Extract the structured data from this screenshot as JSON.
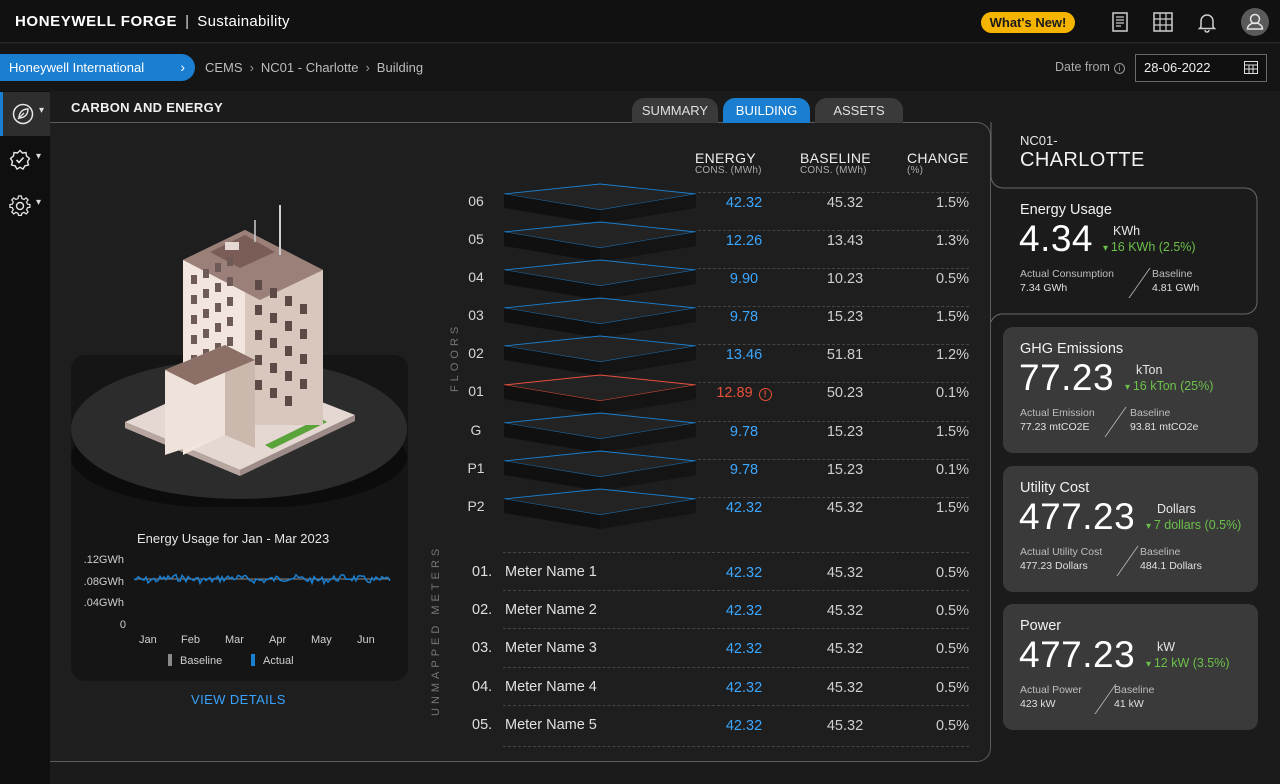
{
  "header": {
    "brand": "HONEYWELL FORGE",
    "separator": "|",
    "product": "Sustainability",
    "whats_new": "What's New!",
    "icons": [
      "document-icon",
      "grid-icon",
      "bell-icon",
      "user-icon"
    ]
  },
  "breadcrumb": {
    "tenant": "Honeywell International",
    "tenant_chevron": "›",
    "items": [
      "CEMS",
      "NC01 - Charlotte",
      "Building"
    ],
    "separator": "›",
    "date_label": "Date from",
    "date_value": "28-06-2022"
  },
  "sidenav": {
    "items": [
      {
        "icon": "leaf-icon",
        "active": true
      },
      {
        "icon": "badge-check-icon",
        "active": false
      },
      {
        "icon": "gear-icon",
        "active": false
      }
    ]
  },
  "section": {
    "title": "CARBON AND ENERGY"
  },
  "tabs": [
    {
      "label": "SUMMARY",
      "active": false
    },
    {
      "label": "BUILDING",
      "active": true
    },
    {
      "label": "ASSETS",
      "active": false
    }
  ],
  "mini_chart": {
    "title": "Energy Usage for  Jan - Mar 2023",
    "yticks": [
      ".12GWh",
      ".08GWh",
      ".04GWh",
      "0"
    ],
    "xticks": [
      "Jan",
      "Feb",
      "Mar",
      "Apr",
      "May",
      "Jun"
    ],
    "legend": [
      {
        "label": "Baseline",
        "color": "#8a8a8a"
      },
      {
        "label": "Actual",
        "color": "#1a7fd0"
      }
    ]
  },
  "view_details": "VIEW DETAILS",
  "table": {
    "headers": {
      "energy": "ENERGY",
      "energy_sub": "CONS. (MWh)",
      "baseline": "BASELINE",
      "baseline_sub": "CONS. (MWh)",
      "change": "CHANGE",
      "change_sub": "(%)"
    },
    "floors_label": "FLOORS",
    "unmapped_label": "UNMAPPED METERS",
    "floors": [
      {
        "name": "06",
        "energy": "42.32",
        "baseline": "45.32",
        "change": "1.5%",
        "alert": false
      },
      {
        "name": "05",
        "energy": "12.26",
        "baseline": "13.43",
        "change": "1.3%",
        "alert": false
      },
      {
        "name": "04",
        "energy": "9.90",
        "baseline": "10.23",
        "change": "0.5%",
        "alert": false
      },
      {
        "name": "03",
        "energy": "9.78",
        "baseline": "15.23",
        "change": "1.5%",
        "alert": false
      },
      {
        "name": "02",
        "energy": "13.46",
        "baseline": "51.81",
        "change": "1.2%",
        "alert": false
      },
      {
        "name": "01",
        "energy": "12.89",
        "baseline": "50.23",
        "change": "0.1%",
        "alert": true
      },
      {
        "name": "G",
        "energy": "9.78",
        "baseline": "15.23",
        "change": "1.5%",
        "alert": false
      },
      {
        "name": "P1",
        "energy": "9.78",
        "baseline": "15.23",
        "change": "0.1%",
        "alert": false
      },
      {
        "name": "P2",
        "energy": "42.32",
        "baseline": "45.32",
        "change": "1.5%",
        "alert": false
      }
    ],
    "meters": [
      {
        "num": "01.",
        "name": "Meter Name 1",
        "energy": "42.32",
        "baseline": "45.32",
        "change": "0.5%"
      },
      {
        "num": "02.",
        "name": "Meter Name 2",
        "energy": "42.32",
        "baseline": "45.32",
        "change": "0.5%"
      },
      {
        "num": "03.",
        "name": "Meter Name 3",
        "energy": "42.32",
        "baseline": "45.32",
        "change": "0.5%"
      },
      {
        "num": "04.",
        "name": "Meter Name 4",
        "energy": "42.32",
        "baseline": "45.32",
        "change": "0.5%"
      },
      {
        "num": "05.",
        "name": "Meter Name 5",
        "energy": "42.32",
        "baseline": "45.32",
        "change": "0.5%"
      }
    ]
  },
  "location": {
    "small": "NC01-",
    "big": "CHARLOTTE"
  },
  "metrics": [
    {
      "title": "Energy Usage",
      "value": "4.34",
      "unit": "KWh",
      "delta": "16 KWh (2.5%)",
      "left_label": "Actual Consumption",
      "left_value": "7.34  GWh",
      "right_label": "Baseline",
      "right_value": "4.81  GWh"
    },
    {
      "title": "GHG Emissions",
      "value": "77.23",
      "unit": "kTon",
      "delta": "16 kTon (25%)",
      "left_label": "Actual Emission",
      "left_value": "77.23  mtCO2E",
      "right_label": "Baseline",
      "right_value": "93.81  mtCO2e"
    },
    {
      "title": "Utility Cost",
      "value": "477.23",
      "unit": "Dollars",
      "delta": "7 dollars (0.5%)",
      "left_label": "Actual Utility Cost",
      "left_value": "477.23  Dollars",
      "right_label": "Baseline",
      "right_value": "484.1  Dollars"
    },
    {
      "title": "Power",
      "value": "477.23",
      "unit": "kW",
      "delta": "12 kW (3.5%)",
      "left_label": "Actual Power",
      "left_value": "423  kW",
      "right_label": "Baseline",
      "right_value": "41  kW"
    }
  ],
  "colors": {
    "accent": "#1a7fd0",
    "positive": "#6cc04a",
    "alert": "#e8503a",
    "badge": "#f4b400"
  }
}
